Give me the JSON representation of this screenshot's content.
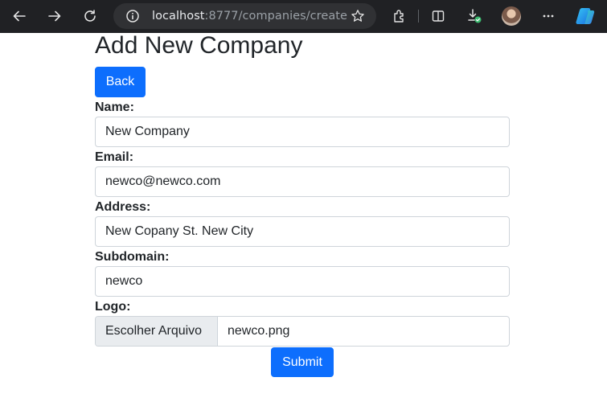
{
  "browser": {
    "url_host": "localhost",
    "url_rest": ":8777/companies/create",
    "icons": {
      "back": "arrow-left-icon",
      "forward": "arrow-right-icon",
      "reload": "reload-icon",
      "info": "info-icon",
      "favorite": "star-icon",
      "extensions": "puzzle-icon",
      "split": "split-screen-icon",
      "downloads": "download-icon",
      "profile": "avatar",
      "menu": "more-icon",
      "copilot": "copilot-icon"
    }
  },
  "page": {
    "title": "Add New Company",
    "back_label": "Back",
    "submit_label": "Submit",
    "accent_color": "#0d6efd"
  },
  "form": {
    "name": {
      "label": "Name:",
      "value": "New Company"
    },
    "email": {
      "label": "Email:",
      "value": "newco@newco.com"
    },
    "address": {
      "label": "Address:",
      "value": "New Copany St. New City"
    },
    "subdomain": {
      "label": "Subdomain:",
      "value": "newco"
    },
    "logo": {
      "label": "Logo:",
      "button_label": "Escolher Arquivo",
      "file_name": "newco.png"
    }
  }
}
